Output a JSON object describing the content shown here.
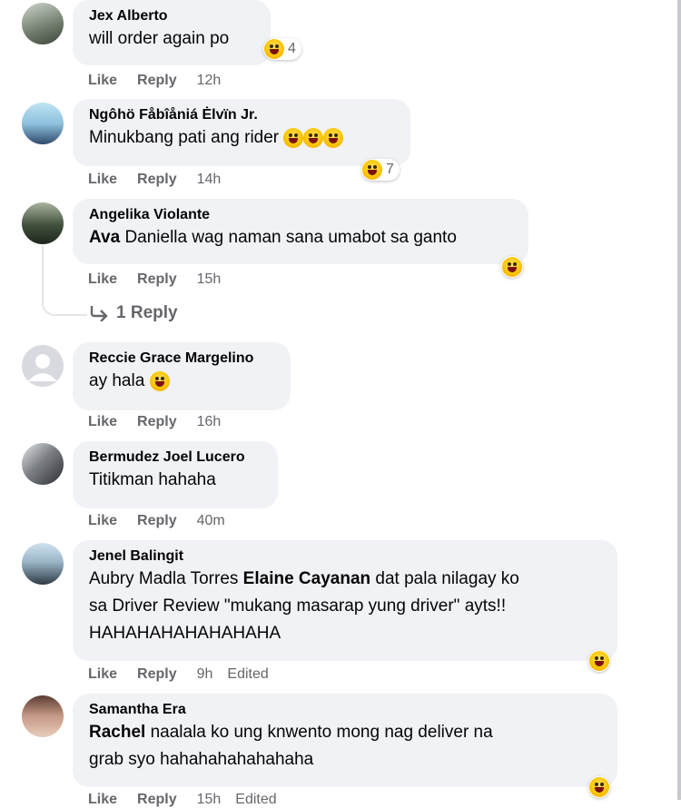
{
  "comments": [
    {
      "name": "Jex Alberto",
      "text": "will order again po",
      "reaction_count": "4",
      "like": "Like",
      "reply": "Reply",
      "time": "12h"
    },
    {
      "name": "Ngôhö Fåbîåniá Ėlvïn Jr.",
      "text": "Minukbang pati ang rider",
      "reaction_count": "7",
      "like": "Like",
      "reply": "Reply",
      "time": "14h"
    },
    {
      "name": "Angelika Violante",
      "mention": "Ava",
      "text": "Daniella wag naman sana umabot sa ganto",
      "like": "Like",
      "reply": "Reply",
      "time": "15h",
      "replies_label": "1 Reply"
    },
    {
      "name": "Reccie Grace Margelino",
      "text": "ay hala",
      "like": "Like",
      "reply": "Reply",
      "time": "16h"
    },
    {
      "name": "Bermudez Joel Lucero",
      "text": "Titikman hahaha",
      "like": "Like",
      "reply": "Reply",
      "time": "40m"
    },
    {
      "name": "Jenel Balingit",
      "line1_pre": "Aubry Madla Torres",
      "line1_mention": "Elaine Cayanan",
      "line1_post": "dat pala nilagay ko",
      "line2": "sa Driver Review \"mukang masarap yung driver\" ayts!!",
      "line3": "HAHAHAHAHAHAHAHA",
      "like": "Like",
      "reply": "Reply",
      "time": "9h",
      "edited": "Edited"
    },
    {
      "name": "Samantha Era",
      "mention": "Rachel",
      "line1_post": "naalala ko ung knwento mong nag deliver na",
      "line2": "grab syo hahahahahahahaha",
      "like": "Like",
      "reply": "Reply",
      "time": "15h",
      "edited": "Edited"
    }
  ],
  "icons": {
    "reply_arrow": "reply-arrow-icon",
    "reaction": "haha-emoji-icon"
  },
  "colors": {
    "bubble": "#f0f2f5",
    "muted": "#65676b",
    "text": "#050505"
  }
}
